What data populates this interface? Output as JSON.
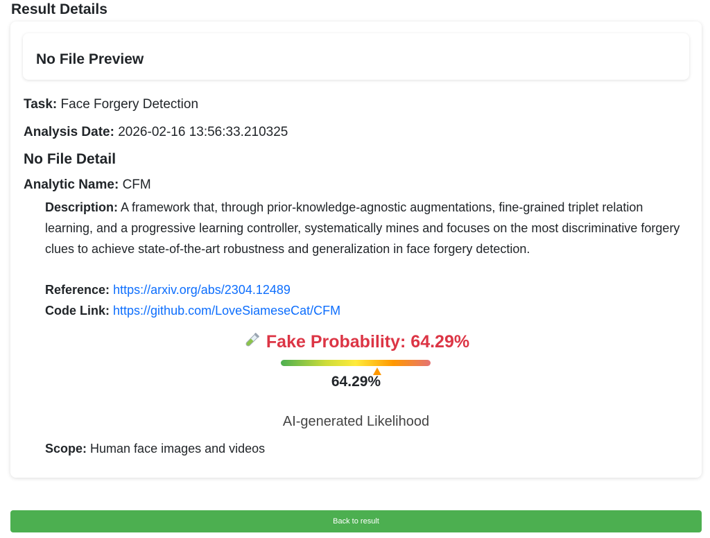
{
  "page": {
    "heading": "Result Details"
  },
  "preview": {
    "title": "No File Preview"
  },
  "task": {
    "label": "Task:",
    "value": "Face Forgery Detection"
  },
  "analysis_date": {
    "label": "Analysis Date:",
    "value": "2026-02-16 13:56:33.210325"
  },
  "file_detail": "No File Detail",
  "analytic": {
    "name_label": "Analytic Name:",
    "name": "CFM",
    "description_label": "Description:",
    "description": "A framework that, through prior-knowledge-agnostic augmentations, fine-grained triplet relation learning, and a progressive learning controller, systematically mines and focuses on the most discriminative forgery clues to achieve state-of-the-art robustness and generalization in face forgery detection.",
    "reference_label": "Reference:",
    "reference_url": "https://arxiv.org/abs/2304.12489",
    "code_label": "Code Link:",
    "code_url": "https://github.com/LoveSiameseCat/CFM",
    "scope_label": "Scope:",
    "scope": "Human face images and videos"
  },
  "probability": {
    "icon": "test-tube-icon",
    "title": "Fake Probability: 64.29%",
    "value_text": "64.29%",
    "fraction": 0.6429,
    "caption": "AI-generated Likelihood",
    "color": "#dc3545"
  },
  "actions": {
    "back_label": "Back to result",
    "back_color": "#4caf50"
  }
}
